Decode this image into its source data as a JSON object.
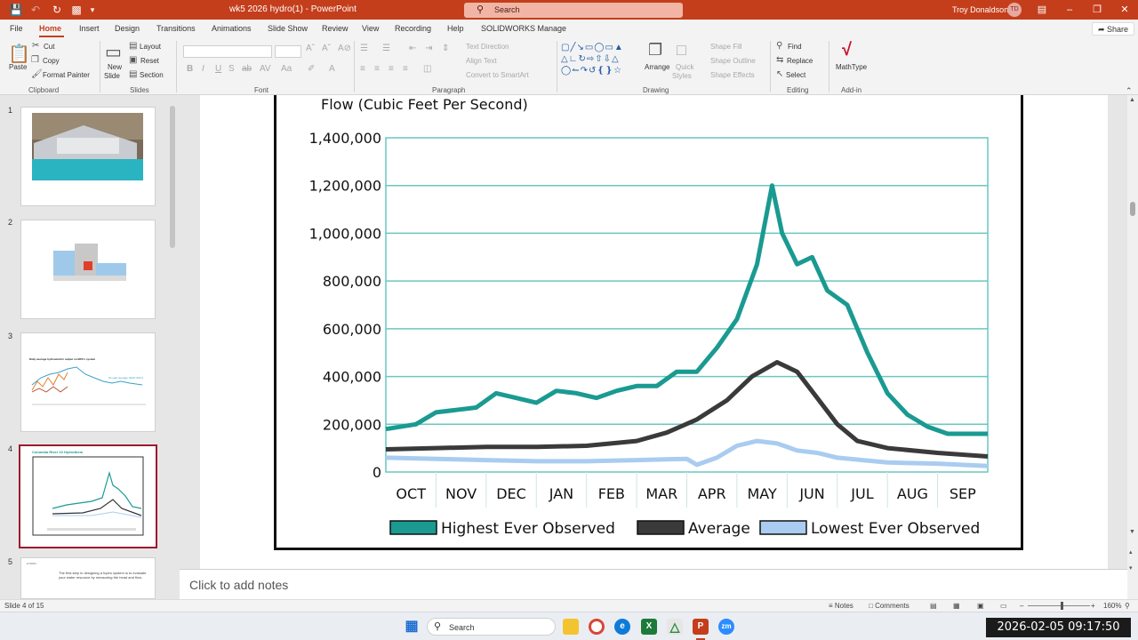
{
  "titlebar": {
    "doc_title": "wk5 2026 hydro(1)  -  PowerPoint",
    "search_placeholder": "Search",
    "user_name": "Troy Donaldson",
    "user_initials": "TD"
  },
  "tabs": [
    "File",
    "Home",
    "Insert",
    "Design",
    "Transitions",
    "Animations",
    "Slide Show",
    "Review",
    "View",
    "Recording",
    "Help",
    "SOLIDWORKS Manage"
  ],
  "share_label": "Share",
  "ribbon": {
    "clipboard": {
      "paste": "Paste",
      "cut": "Cut",
      "copy": "Copy",
      "format_painter": "Format Painter",
      "label": "Clipboard"
    },
    "slides": {
      "new_slide": "New",
      "new_slide2": "Slide",
      "layout": "Layout",
      "reset": "Reset",
      "section": "Section",
      "label": "Slides"
    },
    "font": {
      "label": "Font"
    },
    "paragraph": {
      "text_direction": "Text Direction",
      "align_text": "Align Text",
      "convert_smartart": "Convert to SmartArt",
      "label": "Paragraph"
    },
    "drawing": {
      "arrange": "Arrange",
      "quick_styles": "Quick",
      "quick_styles2": "Styles",
      "shape_fill": "Shape Fill",
      "shape_outline": "Shape Outline",
      "shape_effects": "Shape Effects",
      "label": "Drawing"
    },
    "editing": {
      "find": "Find",
      "replace": "Replace",
      "select": "Select",
      "label": "Editing"
    },
    "addin": {
      "mathtype": "MathType",
      "label": "Add-in"
    }
  },
  "thumbnails": [
    {
      "number": "1"
    },
    {
      "number": "2"
    },
    {
      "number": "3",
      "title": "Daily average hydroelectric output on BPA's system",
      "note": "10-year average (2007-2017)"
    },
    {
      "number": "4",
      "title": "Columbia River 10 Hydrothem"
    },
    {
      "number": "5",
      "text": "The first step in designing a hydro system is to evaluate your water resource by measuring the head and flow."
    }
  ],
  "chart_data": {
    "type": "line",
    "ylabel": "Flow (Cubic Feet Per Second)",
    "yticks": [
      "1,400,000",
      "1,200,000",
      "1,000,000",
      "800,000",
      "600,000",
      "400,000",
      "200,000",
      "0"
    ],
    "ylim": [
      0,
      1400000
    ],
    "categories": [
      "OCT",
      "NOV",
      "DEC",
      "JAN",
      "FEB",
      "MAR",
      "APR",
      "MAY",
      "JUN",
      "JUL",
      "AUG",
      "SEP"
    ],
    "series": [
      {
        "name": "Highest Ever Observed",
        "color": "#1a9a91",
        "values": [
          [
            0,
            180000
          ],
          [
            0.6,
            200000
          ],
          [
            1.0,
            250000
          ],
          [
            1.4,
            260000
          ],
          [
            1.8,
            270000
          ],
          [
            2.2,
            330000
          ],
          [
            2.6,
            310000
          ],
          [
            3.0,
            290000
          ],
          [
            3.4,
            340000
          ],
          [
            3.8,
            330000
          ],
          [
            4.2,
            310000
          ],
          [
            4.6,
            340000
          ],
          [
            5.0,
            360000
          ],
          [
            5.4,
            360000
          ],
          [
            5.8,
            420000
          ],
          [
            6.2,
            420000
          ],
          [
            6.6,
            520000
          ],
          [
            7.0,
            640000
          ],
          [
            7.4,
            870000
          ],
          [
            7.7,
            1200000
          ],
          [
            7.9,
            1000000
          ],
          [
            8.2,
            870000
          ],
          [
            8.5,
            900000
          ],
          [
            8.8,
            760000
          ],
          [
            9.2,
            700000
          ],
          [
            9.6,
            500000
          ],
          [
            10.0,
            330000
          ],
          [
            10.4,
            240000
          ],
          [
            10.8,
            190000
          ],
          [
            11.2,
            160000
          ],
          [
            12.0,
            160000
          ]
        ]
      },
      {
        "name": "Average",
        "color": "#3a3a3a",
        "values": [
          [
            0,
            95000
          ],
          [
            1,
            100000
          ],
          [
            2,
            105000
          ],
          [
            3,
            105000
          ],
          [
            4,
            110000
          ],
          [
            5,
            130000
          ],
          [
            5.6,
            165000
          ],
          [
            6.2,
            220000
          ],
          [
            6.8,
            300000
          ],
          [
            7.3,
            400000
          ],
          [
            7.8,
            460000
          ],
          [
            8.2,
            420000
          ],
          [
            8.6,
            310000
          ],
          [
            9.0,
            200000
          ],
          [
            9.4,
            130000
          ],
          [
            10.0,
            100000
          ],
          [
            11.0,
            80000
          ],
          [
            12.0,
            65000
          ]
        ]
      },
      {
        "name": "Lowest Ever Observed",
        "color": "#a9ccf0",
        "values": [
          [
            0,
            60000
          ],
          [
            1,
            55000
          ],
          [
            2,
            50000
          ],
          [
            3,
            45000
          ],
          [
            4,
            45000
          ],
          [
            5,
            50000
          ],
          [
            6,
            55000
          ],
          [
            6.2,
            30000
          ],
          [
            6.6,
            60000
          ],
          [
            7.0,
            110000
          ],
          [
            7.4,
            130000
          ],
          [
            7.8,
            120000
          ],
          [
            8.2,
            90000
          ],
          [
            8.6,
            80000
          ],
          [
            9.0,
            60000
          ],
          [
            9.5,
            50000
          ],
          [
            10.0,
            40000
          ],
          [
            11.0,
            35000
          ],
          [
            12.0,
            25000
          ]
        ]
      }
    ]
  },
  "notes_placeholder": "Click to add notes",
  "status": {
    "slide_of": "Slide 4 of 15",
    "notes": "Notes",
    "comments": "Comments",
    "zoom": "160%"
  },
  "taskbar": {
    "search": "Search",
    "clock": "2026-02-05  09:17:50"
  }
}
